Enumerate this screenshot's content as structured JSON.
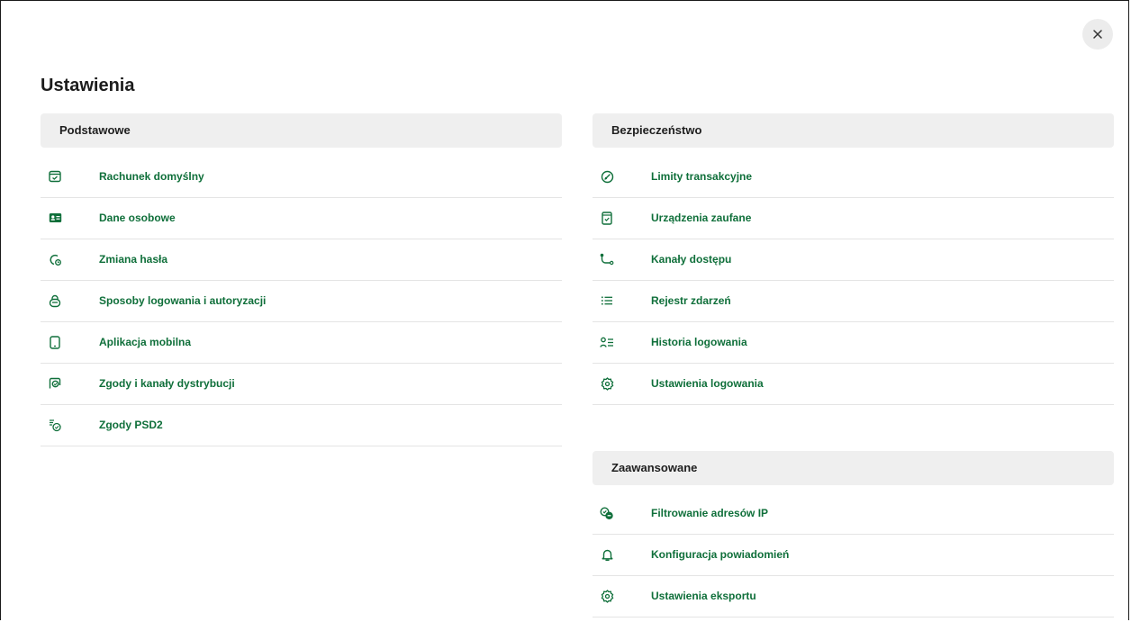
{
  "title": "Ustawienia",
  "close_icon": "close-icon",
  "colors": {
    "accent": "#0f6f3a",
    "section_bg": "#efefef",
    "divider": "#e4e4e4"
  },
  "sections": {
    "podstawowe": {
      "label": "Podstawowe",
      "items": [
        {
          "label": "Rachunek domyślny",
          "icon": "card-check-icon"
        },
        {
          "label": "Dane osobowe",
          "icon": "id-card-icon"
        },
        {
          "label": "Zmiana hasła",
          "icon": "password-change-icon"
        },
        {
          "label": "Sposoby logowania i autoryzacji",
          "icon": "lock-icon"
        },
        {
          "label": "Aplikacja mobilna",
          "icon": "mobile-icon"
        },
        {
          "label": "Zgody i kanały dystrybucji",
          "icon": "consent-icon"
        },
        {
          "label": "Zgody PSD2",
          "icon": "psd2-consent-icon"
        }
      ]
    },
    "bezpieczenstwo": {
      "label": "Bezpieczeństwo",
      "items": [
        {
          "label": "Limity transakcyjne",
          "icon": "gauge-icon"
        },
        {
          "label": "Urządzenia zaufane",
          "icon": "trusted-device-icon"
        },
        {
          "label": "Kanały dostępu",
          "icon": "route-icon"
        },
        {
          "label": "Rejestr zdarzeń",
          "icon": "list-icon"
        },
        {
          "label": "Historia logowania",
          "icon": "user-history-icon"
        },
        {
          "label": "Ustawienia logowania",
          "icon": "gear-icon"
        }
      ]
    },
    "zaawansowane": {
      "label": "Zaawansowane",
      "items": [
        {
          "label": "Filtrowanie adresów IP",
          "icon": "ip-filter-icon"
        },
        {
          "label": "Konfiguracja powiadomień",
          "icon": "bell-icon"
        },
        {
          "label": "Ustawienia eksportu",
          "icon": "gear-icon"
        }
      ]
    }
  }
}
